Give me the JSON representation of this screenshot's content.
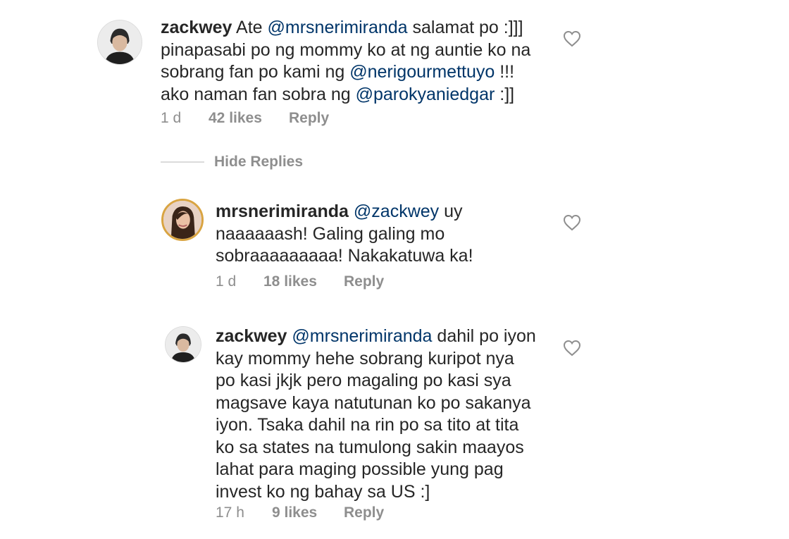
{
  "comments": [
    {
      "username": "zackwey",
      "lines": [
        [
          {
            "t": "Ate "
          },
          {
            "t": "@mrsnerimiranda",
            "m": true
          },
          {
            "t": " salamat po :]]]"
          }
        ],
        [
          {
            "t": "pinapasabi po ng mommy ko at ng auntie ko na"
          }
        ],
        [
          {
            "t": "sobrang fan po kami ng "
          },
          {
            "t": "@nerigourmettuyo",
            "m": true
          },
          {
            "t": " !!!"
          }
        ],
        [
          {
            "t": "ako naman fan sobra ng "
          },
          {
            "t": "@parokyaniedgar",
            "m": true
          },
          {
            "t": " :]]"
          }
        ]
      ],
      "time": "1 d",
      "likes": "42 likes",
      "reply": "Reply"
    },
    {
      "username": "mrsnerimiranda",
      "lines": [
        [
          {
            "t": "@zackwey",
            "m": true
          },
          {
            "t": " uy"
          }
        ],
        [
          {
            "t": "naaaaaash! Galing galing mo"
          }
        ],
        [
          {
            "t": "sobraaaaaaaaa! Nakakatuwa ka!"
          }
        ]
      ],
      "time": "1 d",
      "likes": "18 likes",
      "reply": "Reply"
    },
    {
      "username": "zackwey",
      "lines": [
        [
          {
            "t": "@mrsnerimiranda",
            "m": true
          },
          {
            "t": " dahil po iyon"
          }
        ],
        [
          {
            "t": "kay mommy hehe sobrang kuripot nya"
          }
        ],
        [
          {
            "t": "po kasi jkjk pero magaling po kasi sya"
          }
        ],
        [
          {
            "t": "magsave kaya natutunan ko po sakanya"
          }
        ],
        [
          {
            "t": "iyon. Tsaka dahil na rin po sa tito at tita"
          }
        ],
        [
          {
            "t": "ko sa states na tumulong sakin maayos"
          }
        ],
        [
          {
            "t": "lahat para maging possible yung pag"
          }
        ],
        [
          {
            "t": "invest ko ng bahay sa US :]"
          }
        ]
      ],
      "time": "17 h",
      "likes": "9 likes",
      "reply": "Reply"
    }
  ],
  "hide_replies": "Hide Replies",
  "icons": {
    "like": "heart-outline-icon",
    "avatar": "profile-avatar-icon"
  },
  "colors": {
    "text": "#262626",
    "mention": "#003569",
    "meta": "#8e8e8e",
    "story_ring": "#d9a441"
  }
}
